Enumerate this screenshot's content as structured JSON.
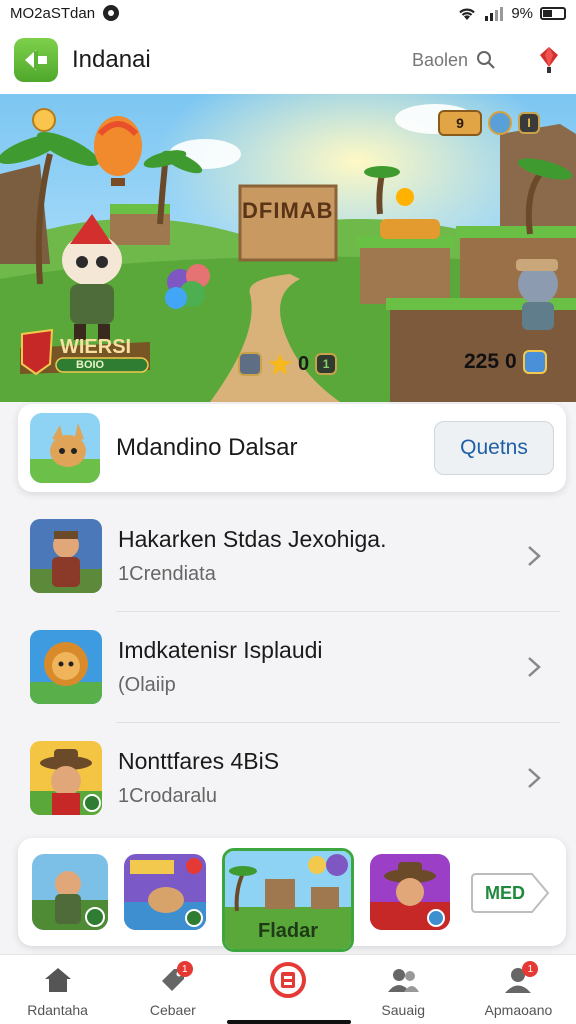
{
  "status_bar": {
    "left_text": "MO2aSTdan",
    "battery": "9%"
  },
  "app_bar": {
    "title": "Indanai",
    "search_placeholder": "Baolen",
    "logo_icon": "arrow-logo-icon",
    "profile_icon": "gem-icon"
  },
  "hero": {
    "sign_text": "DFIMAB",
    "banner_title": "WIERSI",
    "banner_sub": "BOIO",
    "top_counter": "9",
    "center_counter": "0",
    "score": "225",
    "score_counter": "0"
  },
  "featured": {
    "title": "Mdandino Dalsar",
    "button_label": "Quetns"
  },
  "list": [
    {
      "title": "Hakarken Stdas Jexohiga.",
      "subtitle": "1Crendiata",
      "icon": "warrior-thumb"
    },
    {
      "title": "Imdkatenisr Isplaudi",
      "subtitle": "(Olaiip",
      "icon": "lion-thumb"
    },
    {
      "title": "Nonttfares 4BiS",
      "subtitle": "1Crodaralu",
      "icon": "cowboy-thumb"
    }
  ],
  "carousel": {
    "featured_label": "Fladar",
    "more_label": "MED"
  },
  "bottom_nav": [
    {
      "label": "Rdantaha",
      "icon": "home-icon",
      "badge": ""
    },
    {
      "label": "Cebaer",
      "icon": "tag-icon",
      "badge": "1"
    },
    {
      "label": "",
      "icon": "center-game-icon",
      "badge": ""
    },
    {
      "label": "Sauaig",
      "icon": "people-icon",
      "badge": ""
    },
    {
      "label": "Apmaoano",
      "icon": "person-icon",
      "badge": "1"
    }
  ],
  "colors": {
    "accent_green": "#4fa82c",
    "link_blue": "#1f5fa8",
    "badge_red": "#e53935"
  }
}
